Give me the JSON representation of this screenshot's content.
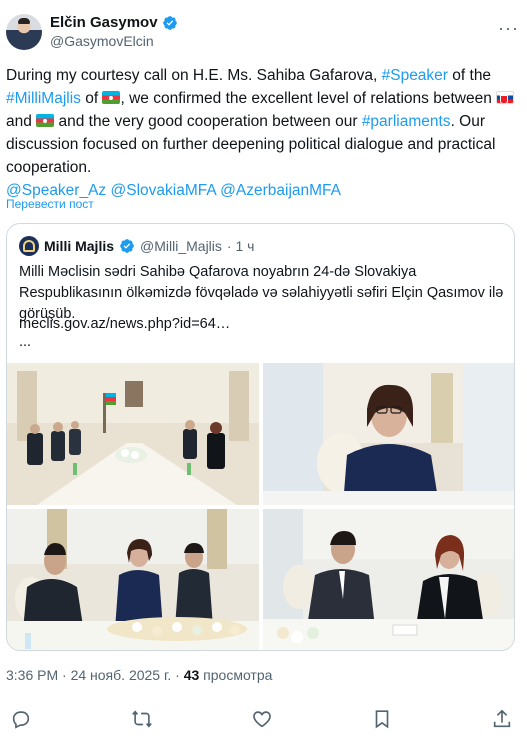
{
  "author": {
    "name": "Elčin Gasymov",
    "handle": "@GasymovElcin"
  },
  "post": {
    "part1": "During my courtesy call on H.E. Ms. Sahiba Gafarova, ",
    "tag_speaker": "#Speaker",
    "part2": " of the ",
    "tag_milli": "#MilliMajlis",
    "part3": " of ",
    "part4": ", we confirmed the excellent level of relations between ",
    "part5": " and ",
    "part6": " and the very good cooperation between our ",
    "tag_parliaments": "#parliaments",
    "part7": ". Our discussion focused on further deepening political dialogue and practical cooperation.",
    "mention1": "@Speaker_Az",
    "mention2": "@SlovakiaMFA",
    "mention3": "@AzerbaijanMFA"
  },
  "translate_label": "Перевести пост",
  "quote": {
    "name": "Milli Majlis",
    "handle": "@Milli_Majlis",
    "time": "· 1 ч",
    "text": "Milli Məclisin sədri Sahibə Qafarova noyabrın 24-də Slovakiya Respublikasının ölkəmizdə fövqəladə və səlahiyyətli səfiri Elçin Qasımov ilə görüşüb.",
    "link": "meclis.gov.az/news.php?id=64…",
    "ellipsis": "..."
  },
  "meta": {
    "time_date": "3:36 PM · 24 нояб. 2025 г. · ",
    "views": "43",
    "views_label": " просмотра"
  },
  "icons": {
    "verified": "verified-badge-icon",
    "more": "more-icon",
    "reply": "reply-icon",
    "retweet": "retweet-icon",
    "like": "like-icon",
    "bookmark": "bookmark-icon",
    "share": "share-icon"
  },
  "colors": {
    "link": "#1d9bf0",
    "secondary": "#536471",
    "border": "#cfd9de"
  }
}
